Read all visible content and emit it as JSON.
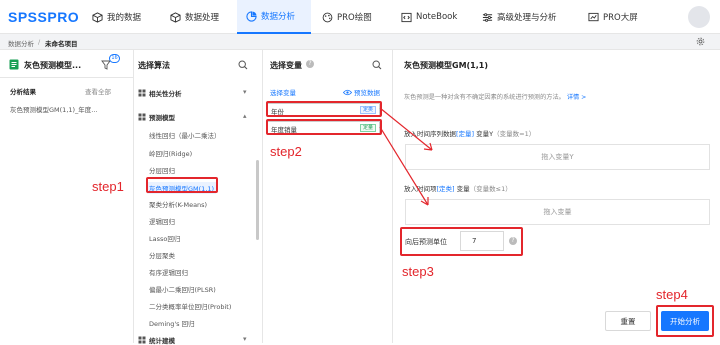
{
  "nav": {
    "logo": "SPSSPRO",
    "items": [
      {
        "label": "我的数据",
        "icon": "cube-icon"
      },
      {
        "label": "数据处理",
        "icon": "box-icon"
      },
      {
        "label": "数据分析",
        "icon": "pie-icon"
      },
      {
        "label": "PRO绘图",
        "icon": "palette-icon"
      },
      {
        "label": "NoteBook",
        "icon": "code-icon"
      },
      {
        "label": "高级处理与分析",
        "icon": "sliders-icon"
      },
      {
        "label": "PRO大屏",
        "icon": "chart-screen-icon"
      }
    ],
    "active_index": 2
  },
  "breadcrumb": {
    "root": "数据分析",
    "sep": "/",
    "current": "未命名项目"
  },
  "left_panel": {
    "title": "灰色预测模型...",
    "badge": "16",
    "results_label": "分析结果",
    "view_all": "查看全部",
    "result_item": "灰色预测模型GM(1,1)_年度..."
  },
  "algo_panel": {
    "title": "选择算法",
    "groups": [
      "相关性分析",
      "预测模型",
      "统计建模"
    ],
    "items": [
      "线性回归（最小二乘法）",
      "岭回归(Ridge)",
      "分层回归",
      "灰色预测模型GM(1,1)",
      "聚类分析(K-Means)",
      "逻辑回归",
      "Lasso回归",
      "分层聚类",
      "有序逻辑回归",
      "偏最小二乘回归(PLSR)",
      "二分类概率单位回归(Probit)",
      "Deming's 回归"
    ]
  },
  "var_panel": {
    "title": "选择变量",
    "select_label": "选择变量",
    "preview_label": "预览数据",
    "vars": [
      {
        "name": "年份",
        "tag": "定类"
      },
      {
        "name": "年度销量",
        "tag": "定量"
      }
    ]
  },
  "config": {
    "title": "灰色预测模型GM(1,1)",
    "desc": "灰色预测是一种对含有不确定因素的系统进行预测的方法。",
    "detail_link": "详情 >",
    "y_label_prefix": "放入时间序列数据",
    "y_label_tag": "[定量]",
    "y_label_var": "变量Y",
    "y_label_count": "（变量数=1）",
    "y_drop": "拖入变量Y",
    "t_label_prefix": "放入时间项",
    "t_label_tag": "[定类]",
    "t_label_var": "变量",
    "t_label_count": "（变量数≤1）",
    "t_drop": "拖入变量",
    "forecast_label": "向后预测单位",
    "forecast_value": "7",
    "reset_label": "重置",
    "start_label": "开始分析"
  },
  "annotations": {
    "step1": "step1",
    "step2": "step2",
    "step3": "step3",
    "step4": "step4"
  },
  "colors": {
    "accent": "#1677ff",
    "annotation": "#e3262c"
  }
}
